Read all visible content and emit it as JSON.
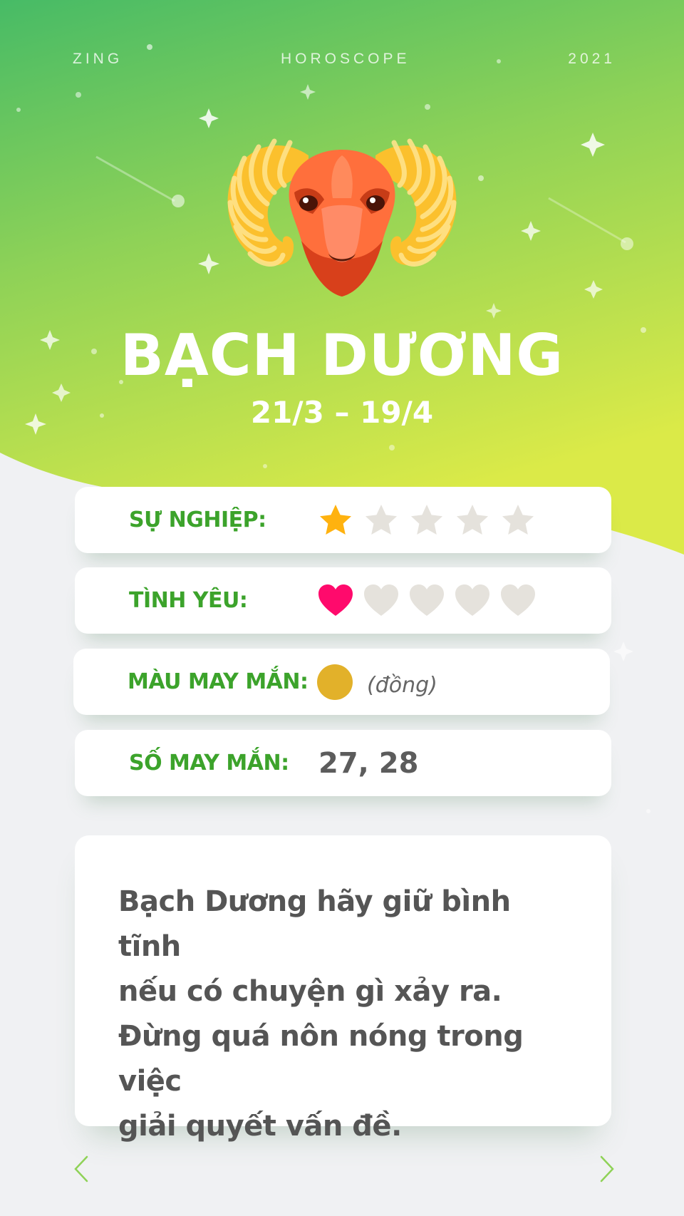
{
  "header": {
    "left": "ZING",
    "center": "HOROSCOPE",
    "right": "2021"
  },
  "sign": {
    "name": "BẠCH DƯƠNG",
    "dates": "21/3 – 19/4",
    "icon": "aries-ram-icon"
  },
  "ratings": {
    "career": {
      "label": "SỰ NGHIỆP:",
      "value": 1,
      "max": 5,
      "icon": "star-icon"
    },
    "love": {
      "label": "TÌNH YÊU:",
      "value": 1,
      "max": 5,
      "icon": "heart-icon"
    }
  },
  "lucky_color": {
    "label": "MÀU MAY MẮN:",
    "name": "(đồng)",
    "hex": "#e2b12a"
  },
  "lucky_numbers": {
    "label": "SỐ MAY MẮN:",
    "value": "27, 28"
  },
  "advice": "Bạch Dương hãy giữ bình tĩnh\nnếu có chuyện gì xảy ra.\nĐừng quá nôn nóng trong việc\ngiải quyết vấn đề.",
  "colors": {
    "accent_green": "#3ca32b",
    "bg_gradient_top": "#4cbe68",
    "bg_gradient_bottom": "#d7e84a",
    "star_active": "#ffb20f",
    "heart_active": "#ff0a6c",
    "inactive": "#e5e2dc"
  },
  "nav": {
    "prev_icon": "chevron-left-icon",
    "next_icon": "chevron-right-icon"
  }
}
